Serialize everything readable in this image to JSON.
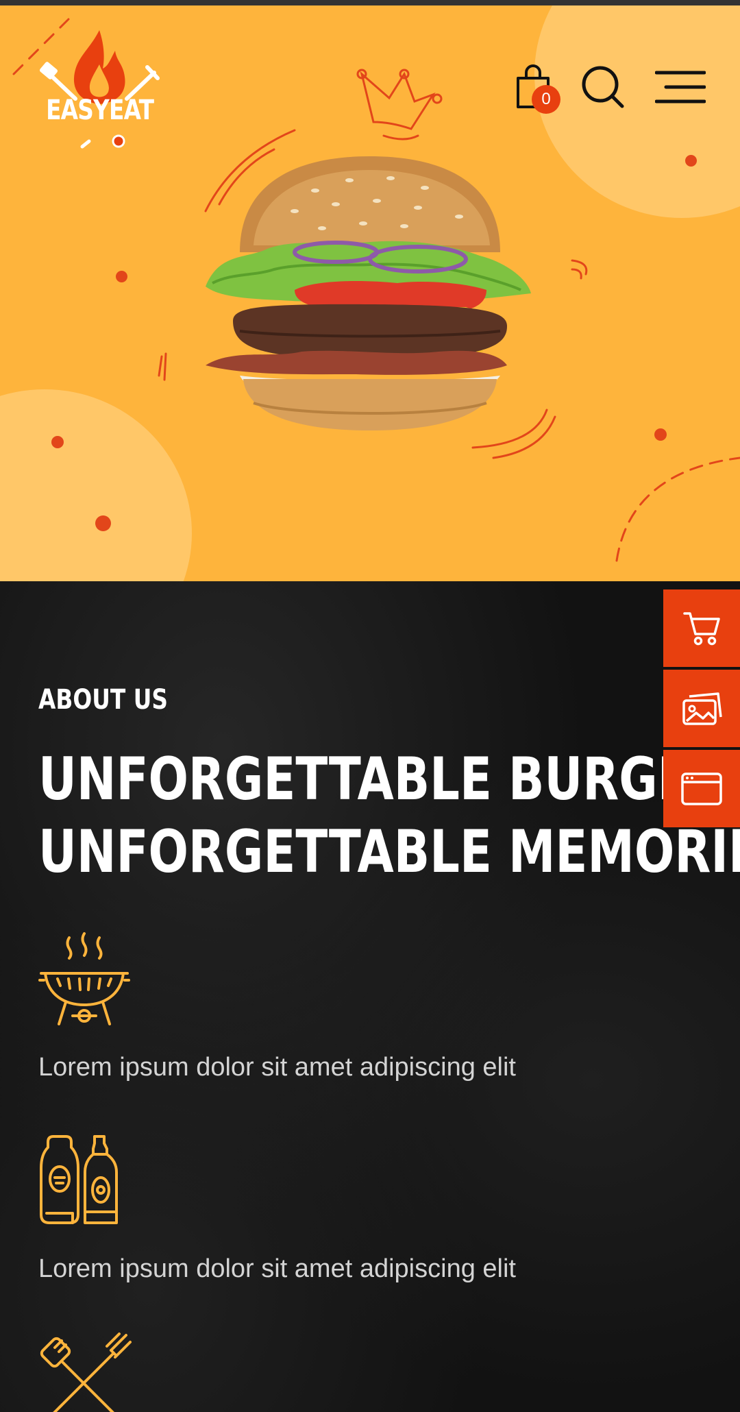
{
  "brand": {
    "name": "EASYEAT",
    "accent_color": "#E8400F",
    "hero_color": "#FEB43C",
    "icon_color": "#FEB43C"
  },
  "header": {
    "cart_count": "0",
    "icons": [
      "shopping-bag-icon",
      "search-icon",
      "hamburger-menu-icon"
    ]
  },
  "hero": {
    "image": "burger-image"
  },
  "side_buttons": [
    {
      "icon": "cart-icon"
    },
    {
      "icon": "gallery-icon"
    },
    {
      "icon": "browser-window-icon"
    }
  ],
  "about": {
    "eyebrow": "ABOUT US",
    "title_line1": "UNFORGETTABLE BURGERS,",
    "title_line2": "UNFORGETTABLE MEMORIES",
    "features": [
      {
        "icon": "grill-icon",
        "text": "Lorem ipsum dolor sit amet adipiscing elit"
      },
      {
        "icon": "sauce-bottles-icon",
        "text": "Lorem ipsum dolor sit amet adipiscing elit"
      },
      {
        "icon": "bbq-tools-icon",
        "text": ""
      }
    ]
  }
}
